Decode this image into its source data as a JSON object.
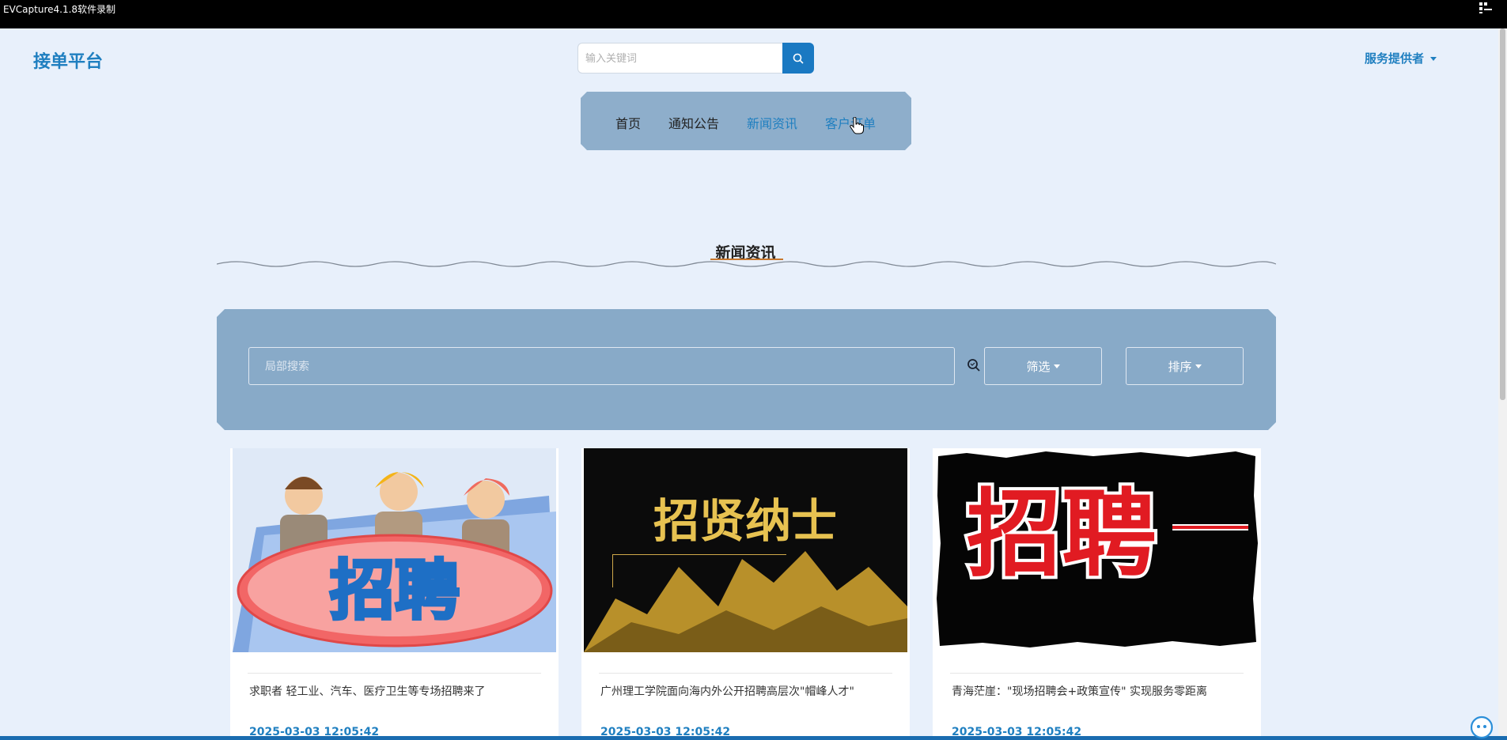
{
  "recorder": {
    "title": "EVCapture4.1.8软件录制"
  },
  "header": {
    "logo": "接单平台",
    "search_placeholder": "输入关键词",
    "provider": "服务提供者"
  },
  "nav": {
    "items": [
      {
        "label": "首页"
      },
      {
        "label": "通知公告"
      },
      {
        "label": "新闻资讯"
      },
      {
        "label": "客户订单"
      }
    ],
    "active": "新闻资讯"
  },
  "section": {
    "title": "新闻资讯"
  },
  "filter": {
    "search_placeholder": "局部搜索",
    "filter_label": "筛选",
    "sort_label": "排序"
  },
  "cards": [
    {
      "title": "求职者 轻工业、汽车、医疗卫生等专场招聘来了",
      "date": "2025-03-03 12:05:42",
      "image_text": "招聘"
    },
    {
      "title": "广州理工学院面向海内外公开招聘高层次\"帽峰人才\"",
      "date": "2025-03-03 12:05:42",
      "image_text": "招贤纳士"
    },
    {
      "title": "青海茫崖：\"现场招聘会+政策宣传\" 实现服务零距离",
      "date": "2025-03-03 12:05:42",
      "image_text": "招聘"
    }
  ],
  "colors": {
    "accent": "#1f7fc0",
    "panel": "#88aac8",
    "background": "#e8f0fb"
  }
}
